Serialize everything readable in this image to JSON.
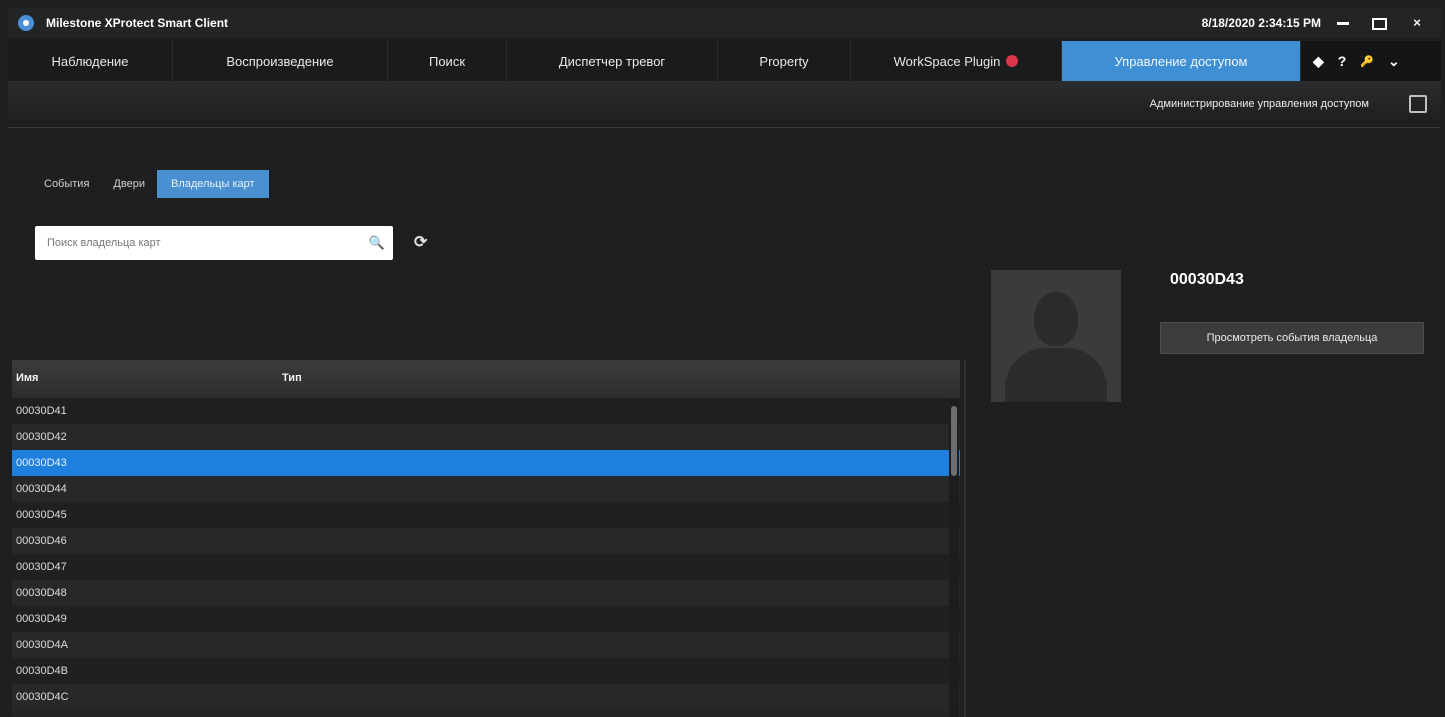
{
  "window": {
    "title": "Milestone XProtect Smart Client",
    "datetime": "8/18/2020 2:34:15 PM",
    "close_glyph": "×"
  },
  "tabs": [
    {
      "label": "Наблюдение"
    },
    {
      "label": "Воспроизведение"
    },
    {
      "label": "Поиск"
    },
    {
      "label": "Диспетчер тревог"
    },
    {
      "label": "Property"
    },
    {
      "label": "WorkSpace Plugin"
    },
    {
      "label": "Управление доступом",
      "active": true
    }
  ],
  "toolbar": {
    "icons": [
      "pin-icon",
      "help-icon",
      "key-icon",
      "chevron-down-icon"
    ],
    "help_glyph": "?",
    "key_glyph": "🔑",
    "chevron_glyph": "⌄",
    "pin_glyph": "◆"
  },
  "subbar": {
    "admin_label": "Администрирование управления доступом"
  },
  "view_tabs": [
    {
      "label": "События"
    },
    {
      "label": "Двери"
    },
    {
      "label": "Владельцы карт",
      "active": true
    }
  ],
  "search": {
    "placeholder": "Поиск владельца карт",
    "search_glyph": "🔍",
    "refresh_glyph": "⟳"
  },
  "table": {
    "columns": [
      "Имя",
      "Тип"
    ],
    "rows": [
      "00030D41",
      "00030D42",
      "00030D43",
      "00030D44",
      "00030D45",
      "00030D46",
      "00030D47",
      "00030D48",
      "00030D49",
      "00030D4A",
      "00030D4B",
      "00030D4C"
    ],
    "selected_index": 2
  },
  "details": {
    "card_id": "00030D43",
    "events_button_label": "Просмотреть события владельца"
  },
  "colors": {
    "accent": "#3f8fd4",
    "selection": "#1e7fdc",
    "background": "#1e1f20"
  }
}
